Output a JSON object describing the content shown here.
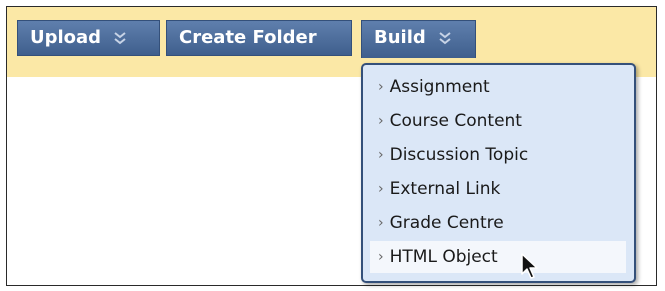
{
  "toolbar": {
    "upload_label": "Upload",
    "create_folder_label": "Create Folder",
    "build_label": "Build"
  },
  "build_menu": {
    "items": [
      {
        "label": "Assignment"
      },
      {
        "label": "Course Content"
      },
      {
        "label": "Discussion Topic"
      },
      {
        "label": "External Link"
      },
      {
        "label": "Grade Centre"
      },
      {
        "label": "HTML Object",
        "hovered": true
      }
    ],
    "arrow_glyph": "›"
  },
  "colors": {
    "toolbar_bg": "#fbe8a6",
    "button_bg": "#4f6f9d",
    "menu_bg": "#dbe7f7",
    "menu_hover_bg": "#f4f7fc"
  },
  "icons": {
    "dropdown": "double-chevron-down-icon",
    "menu_item": "chevron-right-icon",
    "pointer": "mouse-pointer-icon"
  }
}
